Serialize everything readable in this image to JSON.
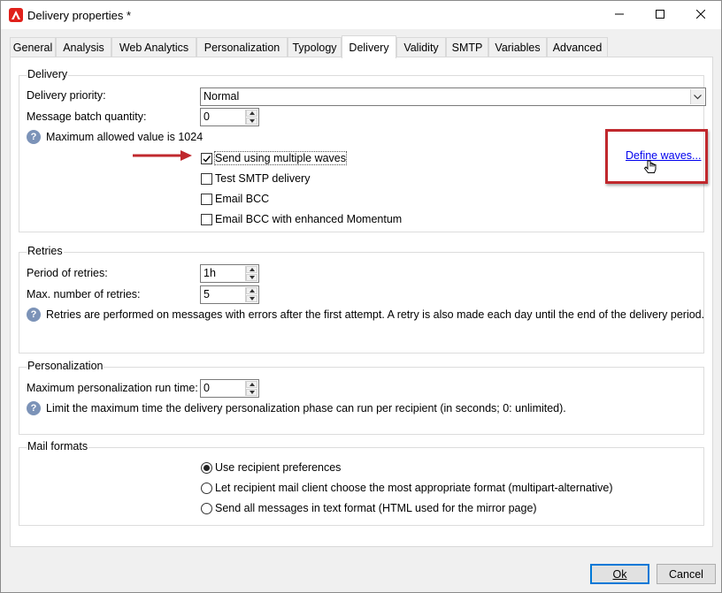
{
  "window": {
    "title": "Delivery properties *",
    "controls": [
      "minimize-icon",
      "maximize-icon",
      "close-icon"
    ]
  },
  "tabs": [
    {
      "label": "General"
    },
    {
      "label": "Analysis"
    },
    {
      "label": "Web Analytics"
    },
    {
      "label": "Personalization"
    },
    {
      "label": "Typology"
    },
    {
      "label": "Delivery",
      "active": true
    },
    {
      "label": "Validity"
    },
    {
      "label": "SMTP"
    },
    {
      "label": "Variables"
    },
    {
      "label": "Advanced"
    }
  ],
  "delivery": {
    "group_label": "Delivery",
    "priority_label": "Delivery priority:",
    "priority_value": "Normal",
    "batch_label": "Message batch quantity:",
    "batch_value": "0",
    "max_note": "Maximum allowed value is 1024",
    "options": [
      {
        "label": "Send using multiple waves",
        "checked": true
      },
      {
        "label": "Test SMTP delivery",
        "checked": false
      },
      {
        "label": "Email BCC",
        "checked": false
      },
      {
        "label": "Email BCC with enhanced Momentum",
        "checked": false
      }
    ],
    "define_waves_link": "Define waves...",
    "highlight_color": "#c0282d"
  },
  "retries": {
    "group_label": "Retries",
    "period_label": "Period of retries:",
    "period_value": "1h",
    "max_label": "Max. number of retries:",
    "max_value": "5",
    "note": "Retries are performed on messages with errors after the first attempt. A retry is also made each day until the end of the delivery period."
  },
  "personalization": {
    "group_label": "Personalization",
    "runtime_label": "Maximum personalization run time:",
    "runtime_value": "0",
    "note": "Limit the maximum time the delivery personalization phase can run per recipient (in seconds; 0: unlimited)."
  },
  "mail_formats": {
    "group_label": "Mail formats",
    "options": [
      {
        "label": "Use recipient preferences",
        "selected": true
      },
      {
        "label": "Let recipient mail client choose the most appropriate format (multipart-alternative)",
        "selected": false
      },
      {
        "label": "Send all messages in text format (HTML used for the mirror page)",
        "selected": false
      }
    ]
  },
  "footer": {
    "ok_label": "Ok",
    "cancel_label": "Cancel"
  },
  "colors": {
    "accent_blue": "#0078d7",
    "help_icon": "#7c93b8",
    "brand_red": "#e0211b"
  }
}
